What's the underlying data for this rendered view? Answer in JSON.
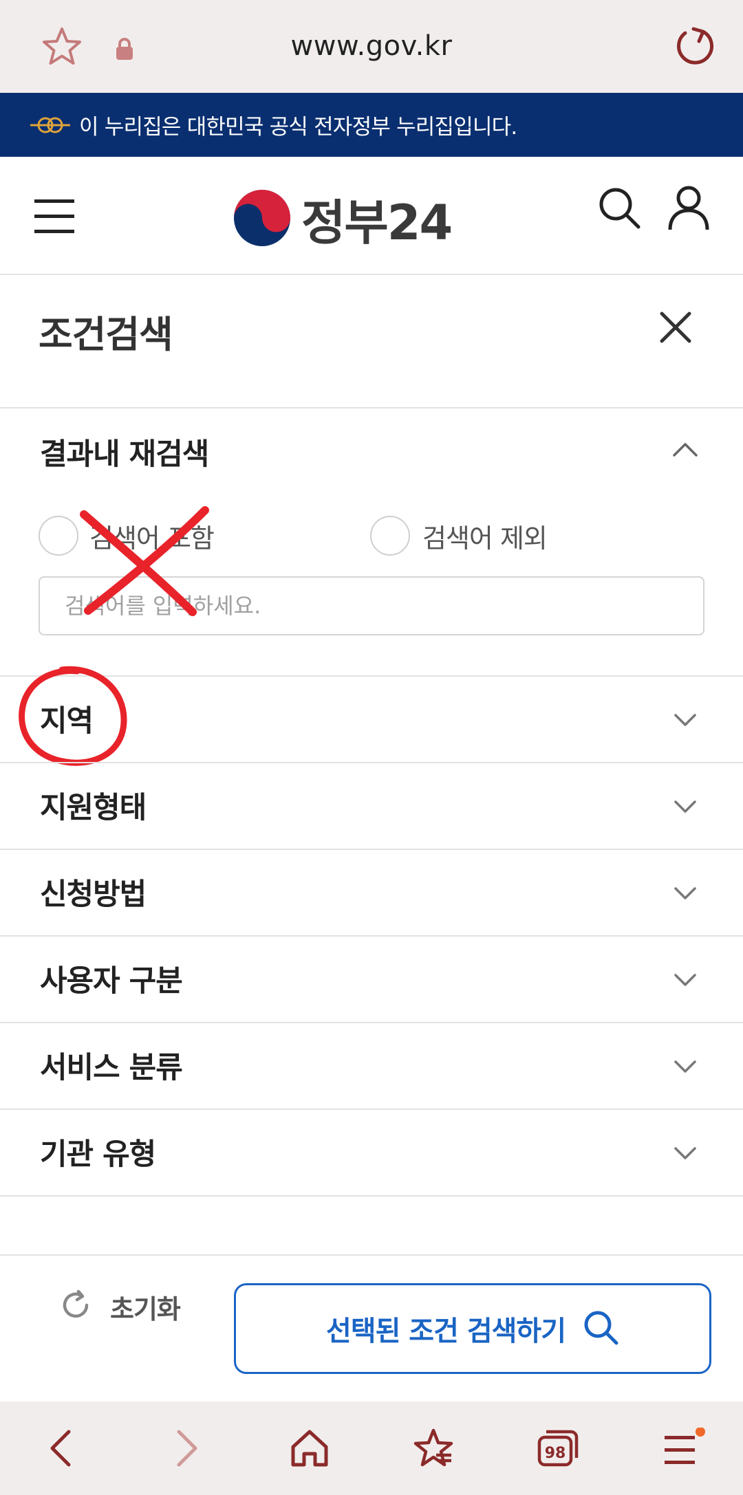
{
  "browser": {
    "url": "www.gov.kr",
    "icons": {
      "bookmark": "star-icon",
      "secure": "lock-icon",
      "reload": "reload-icon"
    }
  },
  "gov_banner": {
    "text": "이 누리집은 대한민국 공식 전자정부 누리집입니다.",
    "icon": "korea-gov-emblem-icon"
  },
  "header": {
    "site_name": "정부24",
    "icons": {
      "menu": "hamburger-menu-icon",
      "search": "search-icon",
      "user": "user-icon"
    }
  },
  "sheet": {
    "title": "조건검색",
    "close_icon": "close-icon",
    "refine": {
      "heading": "결과내 재검색",
      "options": [
        {
          "label": "검색어 포함",
          "selected": false
        },
        {
          "label": "검색어 제외",
          "selected": false
        }
      ],
      "input": {
        "value": "",
        "placeholder": "검색어를 입력하세요."
      }
    },
    "filters": [
      {
        "label": "지역"
      },
      {
        "label": "지원형태"
      },
      {
        "label": "신청방법"
      },
      {
        "label": "사용자 구분"
      },
      {
        "label": "서비스 분류"
      },
      {
        "label": "기관 유형"
      }
    ],
    "reset_label": "초기화",
    "submit_label": "선택된 조건 검색하기"
  },
  "colors": {
    "banner_bg": "#0a2f70",
    "accent_blue": "#1a64c4",
    "browser_icon": "#8b2a2a",
    "annotation_red": "#e8232a"
  },
  "bottom_nav": {
    "tab_count": "98",
    "icons": [
      "back-icon",
      "forward-icon",
      "home-icon",
      "bookmarks-icon",
      "tabs-icon",
      "browser-menu-icon"
    ]
  }
}
